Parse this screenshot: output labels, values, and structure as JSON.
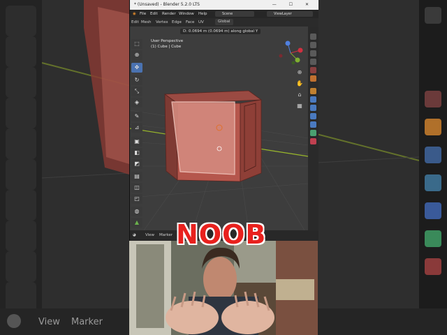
{
  "titlebar": {
    "title": "* (Unsaved) - Blender 5.2.0 LTS",
    "controls": "— ☐ ✕"
  },
  "menubar": {
    "items": [
      "File",
      "Edit",
      "Render",
      "Window",
      "Help"
    ],
    "scene": "Scene",
    "view_layer": "ViewLayer"
  },
  "header": {
    "items": [
      "Edit",
      "Mesh",
      "Vertex",
      "Edge",
      "Face",
      "UV"
    ],
    "orientation": "Global"
  },
  "viewport": {
    "operation": "D:  0.0694 m (0.0694 m) along global Y",
    "perspective": "User Perspective",
    "object": "(1) Cube | Cube"
  },
  "timeline": {
    "view": "View",
    "marker": "Marker"
  },
  "background": {
    "view": "View",
    "marker": "Marker"
  },
  "overlay": {
    "caption": "NOOB"
  },
  "colors": {
    "accent": "#4a72b0",
    "caption": "#e8211e",
    "cube": "#b05a50",
    "x_axis": "#a0c030"
  }
}
